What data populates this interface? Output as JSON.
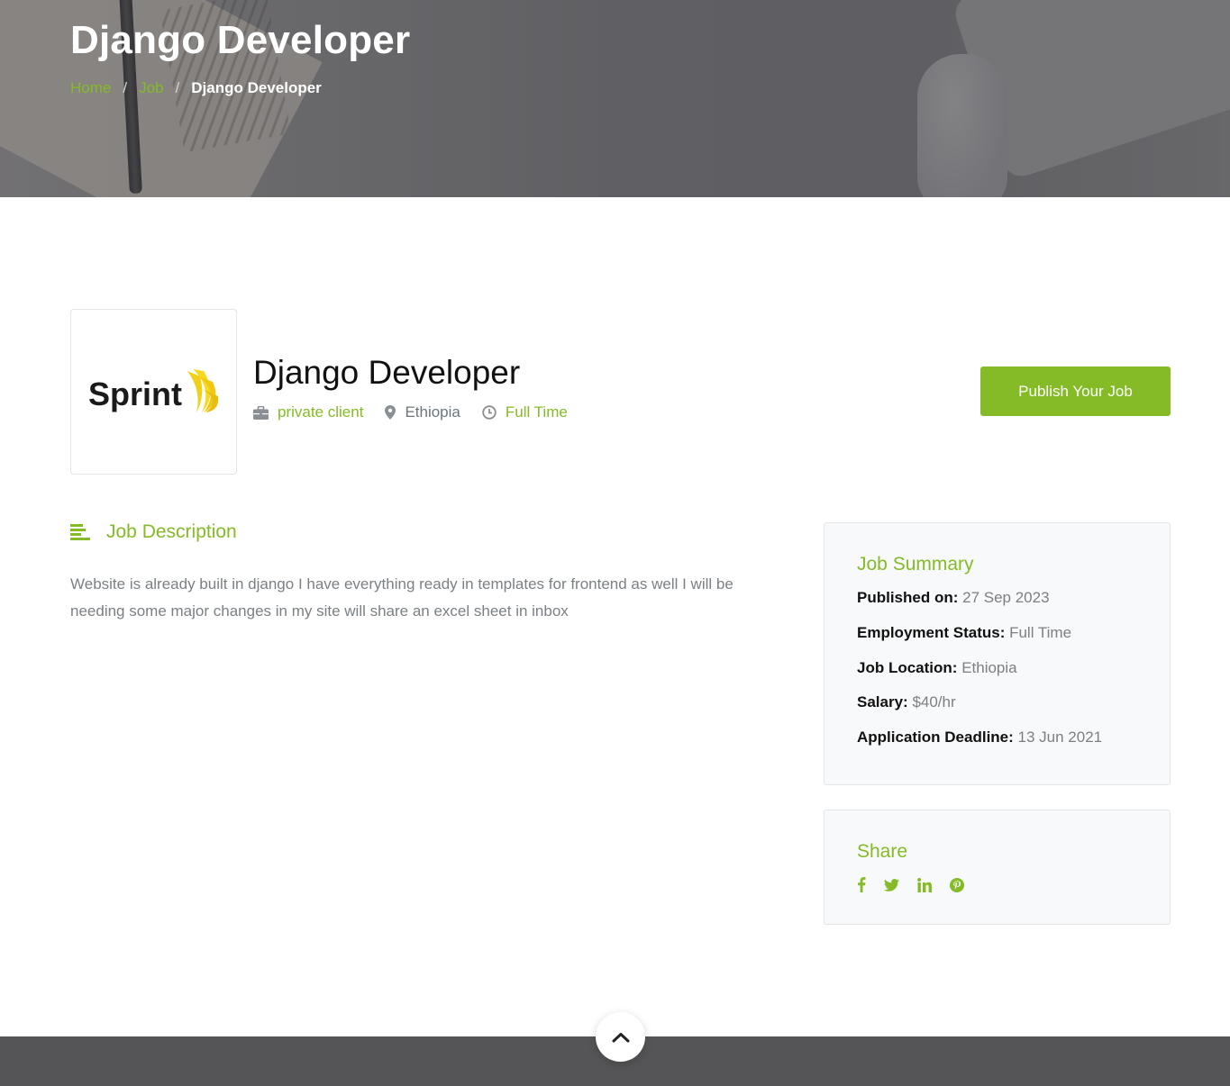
{
  "hero": {
    "title": "Django Developer",
    "breadcrumb": [
      {
        "label": "Home"
      },
      {
        "label": "Job"
      },
      {
        "label": "Django Developer"
      }
    ],
    "separator": "/"
  },
  "job": {
    "logo_text": "Sprint",
    "title": "Django Developer",
    "client": "private client",
    "location": "Ethiopia",
    "type": "Full Time",
    "publish_label": "Publish Your Job"
  },
  "description": {
    "heading": "Job Description",
    "text": "Website is already built in django I have everything ready in templates for frontend as well I will be needing some major changes in my site will share an excel sheet in inbox"
  },
  "summary": {
    "title": "Job Summary",
    "rows": [
      {
        "label": "Published on:",
        "value": "27 Sep 2023"
      },
      {
        "label": "Employment Status:",
        "value": "Full Time"
      },
      {
        "label": "Job Location:",
        "value": "Ethiopia"
      },
      {
        "label": "Salary:",
        "value": "$40/hr"
      },
      {
        "label": "Application Deadline:",
        "value": "13 Jun 2021"
      }
    ]
  },
  "share": {
    "title": "Share",
    "icons": [
      "facebook-icon",
      "twitter-icon",
      "linkedin-icon",
      "pinterest-icon"
    ]
  },
  "colors": {
    "accent": "#84bb26",
    "footer": "#555557",
    "muted_text": "#7b8084"
  }
}
